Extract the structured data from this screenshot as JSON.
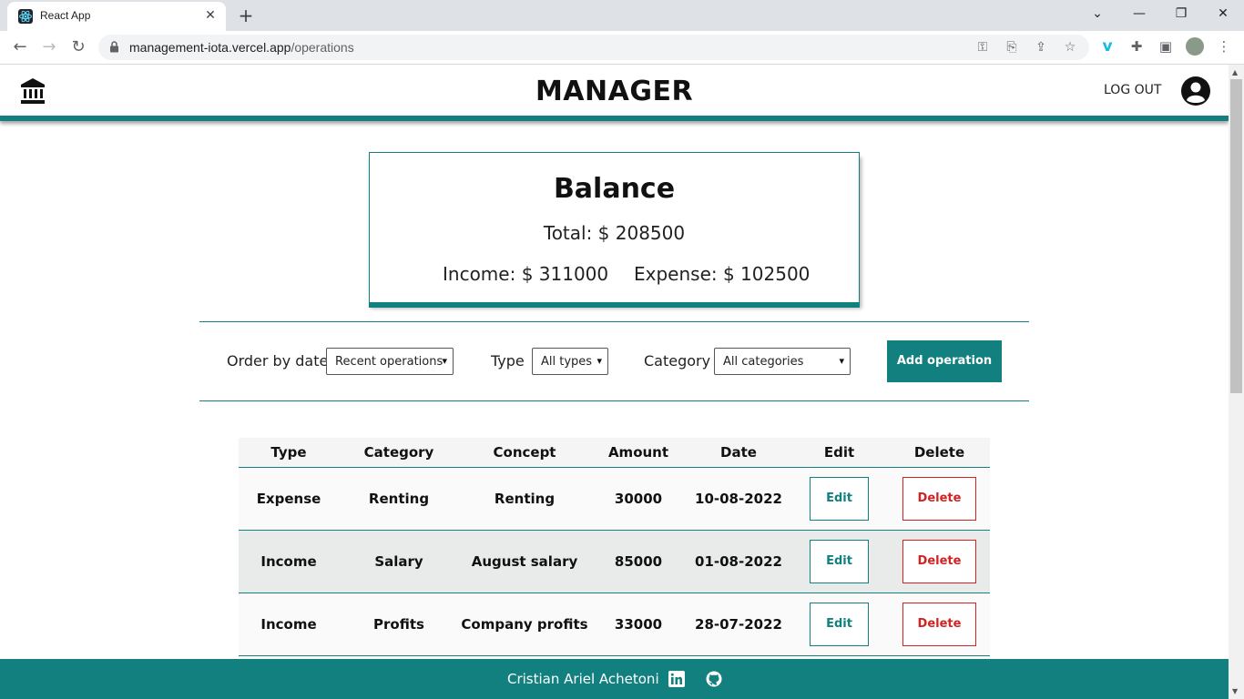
{
  "browser": {
    "tab_title": "React App",
    "url_domain": "management-iota.vercel.app",
    "url_path": "/operations",
    "tab_close": "✕",
    "new_tab": "+",
    "window_controls": [
      "⌄",
      "—",
      "❐",
      "✕"
    ]
  },
  "app": {
    "title": "MANAGER",
    "logout_label": "LOG OUT",
    "accent_color": "#138080",
    "danger_color": "#d32222"
  },
  "balance": {
    "title": "Balance",
    "total": "Total: $ 208500",
    "income": "Income: $ 311000",
    "expense": "Expense: $ 102500"
  },
  "filters": {
    "order_label": "Order by date",
    "order_value": "Recent operations",
    "type_label": "Type",
    "type_value": "All types",
    "category_label": "Category",
    "category_value": "All categories",
    "add_button": "Add operation"
  },
  "table": {
    "headers": [
      "Type",
      "Category",
      "Concept",
      "Amount",
      "Date",
      "Edit",
      "Delete"
    ],
    "rows": [
      {
        "type": "Expense",
        "category": "Renting",
        "concept": "Renting",
        "amount": "30000",
        "date": "10-08-2022",
        "edit": "Edit",
        "delete": "Delete"
      },
      {
        "type": "Income",
        "category": "Salary",
        "concept": "August salary",
        "amount": "85000",
        "date": "01-08-2022",
        "edit": "Edit",
        "delete": "Delete"
      },
      {
        "type": "Income",
        "category": "Profits",
        "concept": "Company profits",
        "amount": "33000",
        "date": "28-07-2022",
        "edit": "Edit",
        "delete": "Delete"
      }
    ]
  },
  "footer": {
    "author": "Cristian Ariel Achetoni"
  }
}
